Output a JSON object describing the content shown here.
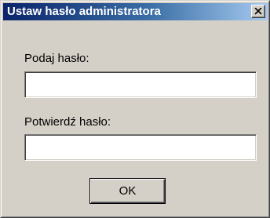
{
  "window": {
    "title": "Ustaw hasło administratora",
    "close_icon": "close-icon"
  },
  "form": {
    "password_label": "Podaj hasło:",
    "password_value": "",
    "confirm_label": "Potwierdź hasło:",
    "confirm_value": ""
  },
  "buttons": {
    "ok_label": "OK"
  },
  "colors": {
    "face": "#d4d0c8",
    "titlebar_start": "#0a246a",
    "titlebar_end": "#a6caf0",
    "title_text": "#ffffff"
  }
}
